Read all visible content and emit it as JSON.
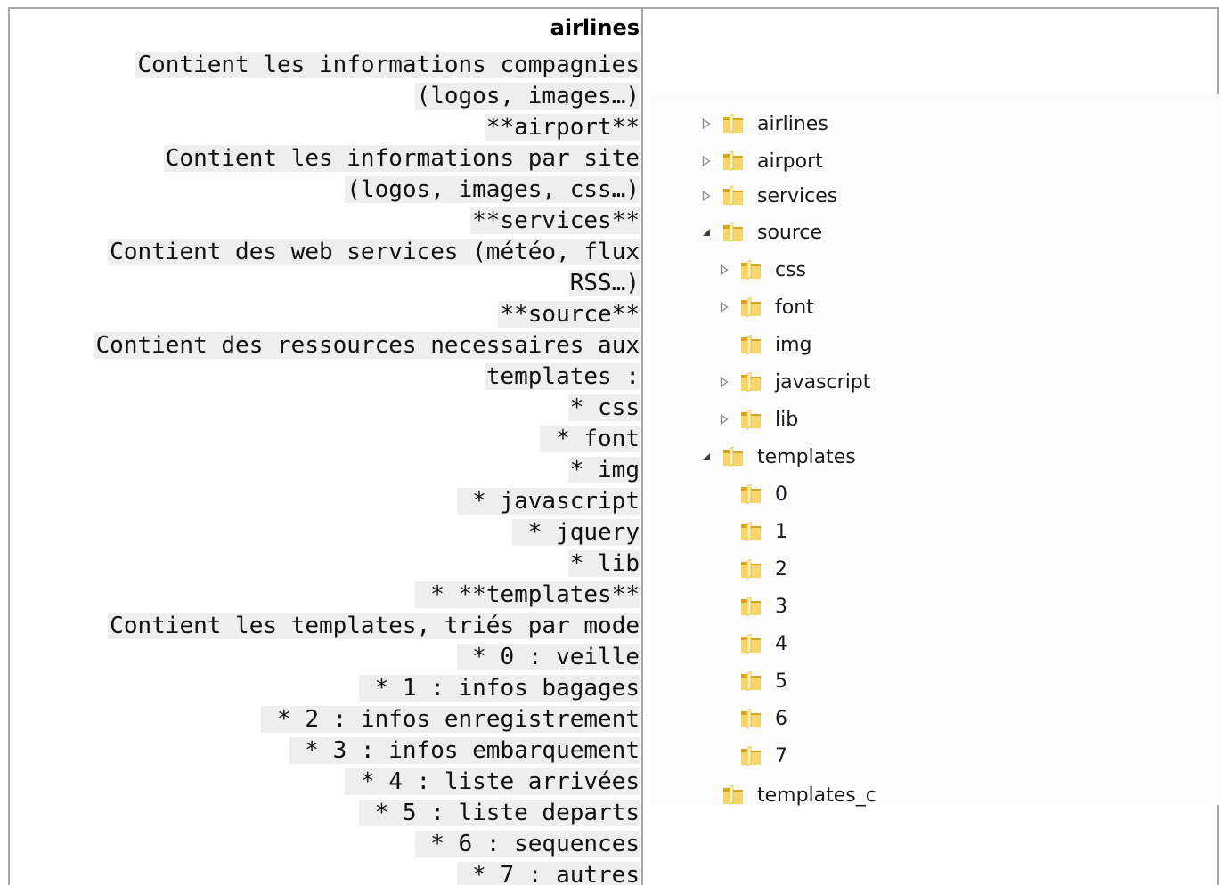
{
  "doc": {
    "title": "airlines",
    "lines": [
      "Contient les informations compagnies",
      "(logos, images…)",
      "**airport**",
      "Contient les informations par site",
      "(logos, images, css…)",
      "**services**",
      "Contient des web services (météo, flux",
      "RSS…)",
      "**source**",
      "Contient des ressources necessaires aux",
      "templates :",
      "* css",
      " * font",
      "* img",
      " * javascript",
      " * jquery",
      "* lib",
      " * **templates**",
      "Contient les templates, triés par mode",
      " * 0 : veille",
      " * 1 : infos bagages",
      " * 2 : infos enregistrement",
      " * 3 : infos embarquement",
      " * 4 : liste arrivées",
      " * 5 : liste departs",
      " * 6 : sequences",
      " * 7 : autres"
    ]
  },
  "explorer": {
    "items": [
      {
        "label": "airlines",
        "arrow": "collapsed"
      },
      {
        "label": "airport",
        "arrow": "collapsed"
      },
      {
        "label": "services",
        "arrow": "collapsed"
      },
      {
        "label": "source",
        "arrow": "expanded"
      },
      {
        "label": "css",
        "arrow": "collapsed"
      },
      {
        "label": "font",
        "arrow": "collapsed"
      },
      {
        "label": "img",
        "arrow": "none"
      },
      {
        "label": "javascript",
        "arrow": "collapsed"
      },
      {
        "label": "lib",
        "arrow": "collapsed"
      },
      {
        "label": "templates",
        "arrow": "expanded"
      },
      {
        "label": "0",
        "arrow": "none"
      },
      {
        "label": "1",
        "arrow": "none"
      },
      {
        "label": "2",
        "arrow": "none"
      },
      {
        "label": "3",
        "arrow": "none"
      },
      {
        "label": "4",
        "arrow": "none"
      },
      {
        "label": "5",
        "arrow": "none"
      },
      {
        "label": "6",
        "arrow": "none"
      },
      {
        "label": "7",
        "arrow": "none"
      },
      {
        "label": "templates_c",
        "arrow": "none"
      }
    ],
    "icons": {
      "folder": "folder-icon",
      "collapsed": "triangle-right-icon",
      "expanded": "triangle-down-icon"
    },
    "colors": {
      "folder_light": "#f6d66b",
      "folder_dark": "#d9a520"
    }
  }
}
